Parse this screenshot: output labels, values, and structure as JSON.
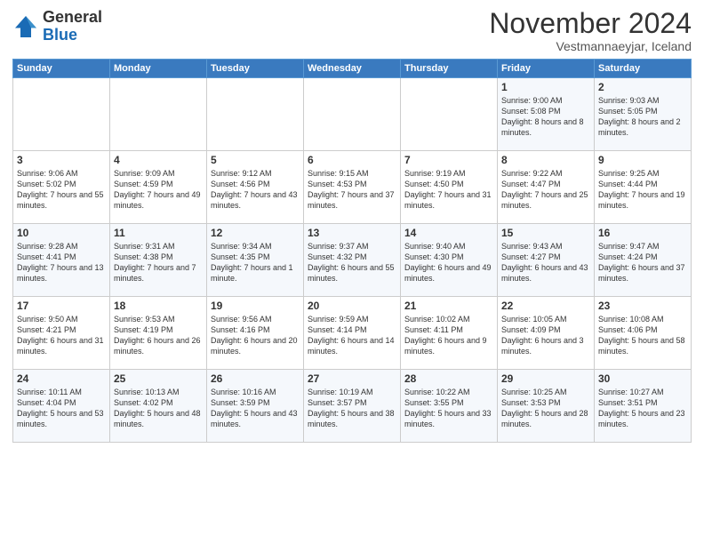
{
  "logo": {
    "general": "General",
    "blue": "Blue"
  },
  "title": "November 2024",
  "location": "Vestmannaeyjar, Iceland",
  "days_of_week": [
    "Sunday",
    "Monday",
    "Tuesday",
    "Wednesday",
    "Thursday",
    "Friday",
    "Saturday"
  ],
  "weeks": [
    [
      {
        "day": "",
        "info": ""
      },
      {
        "day": "",
        "info": ""
      },
      {
        "day": "",
        "info": ""
      },
      {
        "day": "",
        "info": ""
      },
      {
        "day": "",
        "info": ""
      },
      {
        "day": "1",
        "info": "Sunrise: 9:00 AM\nSunset: 5:08 PM\nDaylight: 8 hours\nand 8 minutes."
      },
      {
        "day": "2",
        "info": "Sunrise: 9:03 AM\nSunset: 5:05 PM\nDaylight: 8 hours\nand 2 minutes."
      }
    ],
    [
      {
        "day": "3",
        "info": "Sunrise: 9:06 AM\nSunset: 5:02 PM\nDaylight: 7 hours\nand 55 minutes."
      },
      {
        "day": "4",
        "info": "Sunrise: 9:09 AM\nSunset: 4:59 PM\nDaylight: 7 hours\nand 49 minutes."
      },
      {
        "day": "5",
        "info": "Sunrise: 9:12 AM\nSunset: 4:56 PM\nDaylight: 7 hours\nand 43 minutes."
      },
      {
        "day": "6",
        "info": "Sunrise: 9:15 AM\nSunset: 4:53 PM\nDaylight: 7 hours\nand 37 minutes."
      },
      {
        "day": "7",
        "info": "Sunrise: 9:19 AM\nSunset: 4:50 PM\nDaylight: 7 hours\nand 31 minutes."
      },
      {
        "day": "8",
        "info": "Sunrise: 9:22 AM\nSunset: 4:47 PM\nDaylight: 7 hours\nand 25 minutes."
      },
      {
        "day": "9",
        "info": "Sunrise: 9:25 AM\nSunset: 4:44 PM\nDaylight: 7 hours\nand 19 minutes."
      }
    ],
    [
      {
        "day": "10",
        "info": "Sunrise: 9:28 AM\nSunset: 4:41 PM\nDaylight: 7 hours\nand 13 minutes."
      },
      {
        "day": "11",
        "info": "Sunrise: 9:31 AM\nSunset: 4:38 PM\nDaylight: 7 hours\nand 7 minutes."
      },
      {
        "day": "12",
        "info": "Sunrise: 9:34 AM\nSunset: 4:35 PM\nDaylight: 7 hours\nand 1 minute."
      },
      {
        "day": "13",
        "info": "Sunrise: 9:37 AM\nSunset: 4:32 PM\nDaylight: 6 hours\nand 55 minutes."
      },
      {
        "day": "14",
        "info": "Sunrise: 9:40 AM\nSunset: 4:30 PM\nDaylight: 6 hours\nand 49 minutes."
      },
      {
        "day": "15",
        "info": "Sunrise: 9:43 AM\nSunset: 4:27 PM\nDaylight: 6 hours\nand 43 minutes."
      },
      {
        "day": "16",
        "info": "Sunrise: 9:47 AM\nSunset: 4:24 PM\nDaylight: 6 hours\nand 37 minutes."
      }
    ],
    [
      {
        "day": "17",
        "info": "Sunrise: 9:50 AM\nSunset: 4:21 PM\nDaylight: 6 hours\nand 31 minutes."
      },
      {
        "day": "18",
        "info": "Sunrise: 9:53 AM\nSunset: 4:19 PM\nDaylight: 6 hours\nand 26 minutes."
      },
      {
        "day": "19",
        "info": "Sunrise: 9:56 AM\nSunset: 4:16 PM\nDaylight: 6 hours\nand 20 minutes."
      },
      {
        "day": "20",
        "info": "Sunrise: 9:59 AM\nSunset: 4:14 PM\nDaylight: 6 hours\nand 14 minutes."
      },
      {
        "day": "21",
        "info": "Sunrise: 10:02 AM\nSunset: 4:11 PM\nDaylight: 6 hours\nand 9 minutes."
      },
      {
        "day": "22",
        "info": "Sunrise: 10:05 AM\nSunset: 4:09 PM\nDaylight: 6 hours\nand 3 minutes."
      },
      {
        "day": "23",
        "info": "Sunrise: 10:08 AM\nSunset: 4:06 PM\nDaylight: 5 hours\nand 58 minutes."
      }
    ],
    [
      {
        "day": "24",
        "info": "Sunrise: 10:11 AM\nSunset: 4:04 PM\nDaylight: 5 hours\nand 53 minutes."
      },
      {
        "day": "25",
        "info": "Sunrise: 10:13 AM\nSunset: 4:02 PM\nDaylight: 5 hours\nand 48 minutes."
      },
      {
        "day": "26",
        "info": "Sunrise: 10:16 AM\nSunset: 3:59 PM\nDaylight: 5 hours\nand 43 minutes."
      },
      {
        "day": "27",
        "info": "Sunrise: 10:19 AM\nSunset: 3:57 PM\nDaylight: 5 hours\nand 38 minutes."
      },
      {
        "day": "28",
        "info": "Sunrise: 10:22 AM\nSunset: 3:55 PM\nDaylight: 5 hours\nand 33 minutes."
      },
      {
        "day": "29",
        "info": "Sunrise: 10:25 AM\nSunset: 3:53 PM\nDaylight: 5 hours\nand 28 minutes."
      },
      {
        "day": "30",
        "info": "Sunrise: 10:27 AM\nSunset: 3:51 PM\nDaylight: 5 hours\nand 23 minutes."
      }
    ]
  ]
}
